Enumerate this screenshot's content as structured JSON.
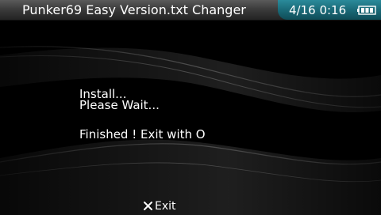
{
  "header": {
    "title": "Punker69 Easy Version.txt Changer",
    "datetime": "4/16 0:16",
    "battery_icon": "battery-full-icon",
    "status_color": "#1a6a78"
  },
  "main": {
    "lines": [
      "Install...",
      "Please Wait..."
    ],
    "finished": "Finished ! Exit with O"
  },
  "footer": {
    "exit_icon": "cross-button-icon",
    "exit_label": "Exit"
  }
}
